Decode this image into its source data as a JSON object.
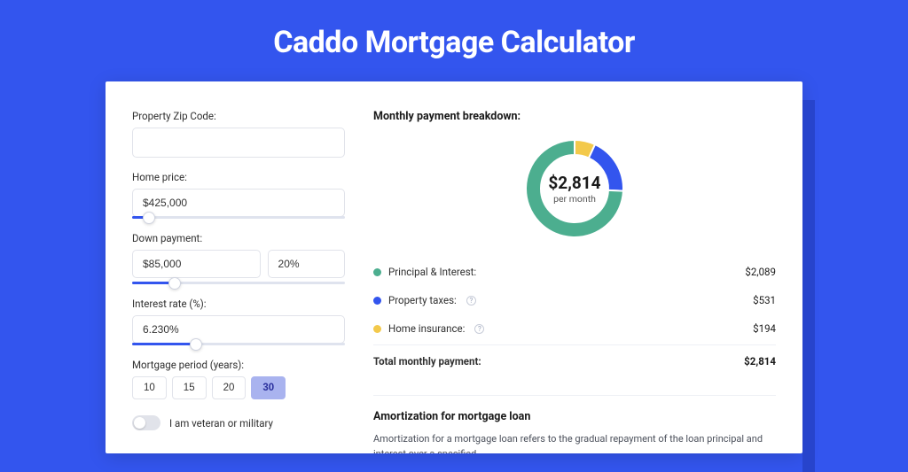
{
  "title": "Caddo Mortgage Calculator",
  "form": {
    "zip_label": "Property Zip Code:",
    "zip_value": "",
    "home_price_label": "Home price:",
    "home_price_value": "$425,000",
    "home_price_slider_pct": 8,
    "down_label": "Down payment:",
    "down_value": "$85,000",
    "down_pct_value": "20%",
    "down_slider_pct": 20,
    "rate_label": "Interest rate (%):",
    "rate_value": "6.230%",
    "rate_slider_pct": 30,
    "period_label": "Mortgage period (years):",
    "periods": [
      "10",
      "15",
      "20",
      "30"
    ],
    "period_active_index": 3,
    "veteran_label": "I am veteran or military",
    "veteran_on": false
  },
  "breakdown": {
    "title": "Monthly payment breakdown:",
    "center_amount": "$2,814",
    "center_sub": "per month",
    "items": [
      {
        "label": "Principal & Interest:",
        "value": "$2,089",
        "color": "#4cae8f",
        "info": false
      },
      {
        "label": "Property taxes:",
        "value": "$531",
        "color": "#3355ee",
        "info": true
      },
      {
        "label": "Home insurance:",
        "value": "$194",
        "color": "#f3c94b",
        "info": true
      }
    ],
    "total_label": "Total monthly payment:",
    "total_value": "$2,814"
  },
  "chart_data": {
    "type": "pie",
    "title": "Monthly payment breakdown",
    "series": [
      {
        "name": "Principal & Interest",
        "value": 2089,
        "color": "#4cae8f"
      },
      {
        "name": "Property taxes",
        "value": 531,
        "color": "#3355ee"
      },
      {
        "name": "Home insurance",
        "value": 194,
        "color": "#f3c94b"
      }
    ],
    "total": 2814,
    "donut": true
  },
  "amort": {
    "title": "Amortization for mortgage loan",
    "text": "Amortization for a mortgage loan refers to the gradual repayment of the loan principal and interest over a specified"
  }
}
